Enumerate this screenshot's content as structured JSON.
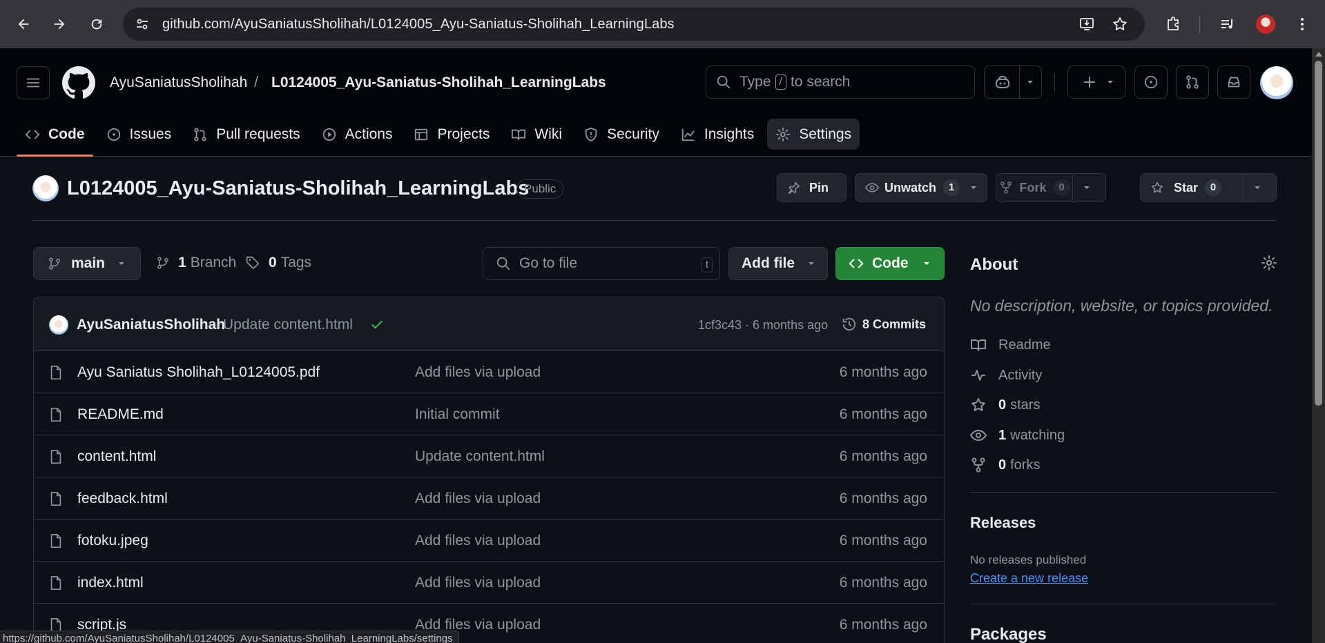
{
  "browser": {
    "url": "github.com/AyuSaniatusSholihah/L0124005_Ayu-Saniatus-Sholihah_LearningLabs",
    "status_url": "https://github.com/AyuSaniatusSholihah/L0124005_Ayu-Saniatus-Sholihah_LearningLabs/settings"
  },
  "header": {
    "owner": "AyuSaniatusSholihah",
    "separator": "/",
    "repo": "L0124005_Ayu-Saniatus-Sholihah_LearningLabs",
    "search": {
      "before": "Type",
      "key": "/",
      "after": "to search"
    }
  },
  "tabs": [
    {
      "label": "Code",
      "icon": "code-icon",
      "active": true
    },
    {
      "label": "Issues",
      "icon": "issue-icon"
    },
    {
      "label": "Pull requests",
      "icon": "pull-request-icon"
    },
    {
      "label": "Actions",
      "icon": "play-icon"
    },
    {
      "label": "Projects",
      "icon": "table-icon"
    },
    {
      "label": "Wiki",
      "icon": "book-icon"
    },
    {
      "label": "Security",
      "icon": "shield-icon"
    },
    {
      "label": "Insights",
      "icon": "graph-icon"
    },
    {
      "label": "Settings",
      "icon": "gear-icon",
      "hover": true
    }
  ],
  "repo": {
    "name": "L0124005_Ayu-Saniatus-Sholihah_LearningLabs",
    "visibility": "Public",
    "pin_label": "Pin",
    "watch_label": "Unwatch",
    "watch_count": "1",
    "fork_label": "Fork",
    "fork_count": "0",
    "star_label": "Star",
    "star_count": "0"
  },
  "toolbar": {
    "branch": "main",
    "branch_count": "1",
    "branch_label": "Branch",
    "tag_count": "0",
    "tag_label": "Tags",
    "goto_placeholder": "Go to file",
    "goto_key": "t",
    "add_file": "Add file",
    "code": "Code"
  },
  "commit": {
    "author": "AyuSaniatusSholihah",
    "message": "Update content.html",
    "meta": "1cf3c43 · 6 months ago",
    "commits": "8 Commits"
  },
  "files": [
    {
      "name": "Ayu Saniatus Sholihah_L0124005.pdf",
      "message": "Add files via upload",
      "age": "6 months ago"
    },
    {
      "name": "README.md",
      "message": "Initial commit",
      "age": "6 months ago"
    },
    {
      "name": "content.html",
      "message": "Update content.html",
      "age": "6 months ago"
    },
    {
      "name": "feedback.html",
      "message": "Add files via upload",
      "age": "6 months ago"
    },
    {
      "name": "fotoku.jpeg",
      "message": "Add files via upload",
      "age": "6 months ago"
    },
    {
      "name": "index.html",
      "message": "Add files via upload",
      "age": "6 months ago"
    },
    {
      "name": "script.js",
      "message": "Add files via upload",
      "age": "6 months ago"
    }
  ],
  "about": {
    "title": "About",
    "description": "No description, website, or topics provided.",
    "readme": "Readme",
    "activity": "Activity",
    "stars_count": "0",
    "stars_label": "stars",
    "watching_count": "1",
    "watching_label": "watching",
    "forks_count": "0",
    "forks_label": "forks"
  },
  "releases": {
    "title": "Releases",
    "empty": "No releases published",
    "create_link": "Create a new release"
  },
  "packages": {
    "title": "Packages"
  },
  "colors": {
    "accent_green": "#238636",
    "tab_underline": "#f78166",
    "link_blue": "#4493f8",
    "bg": "#0d1117"
  }
}
